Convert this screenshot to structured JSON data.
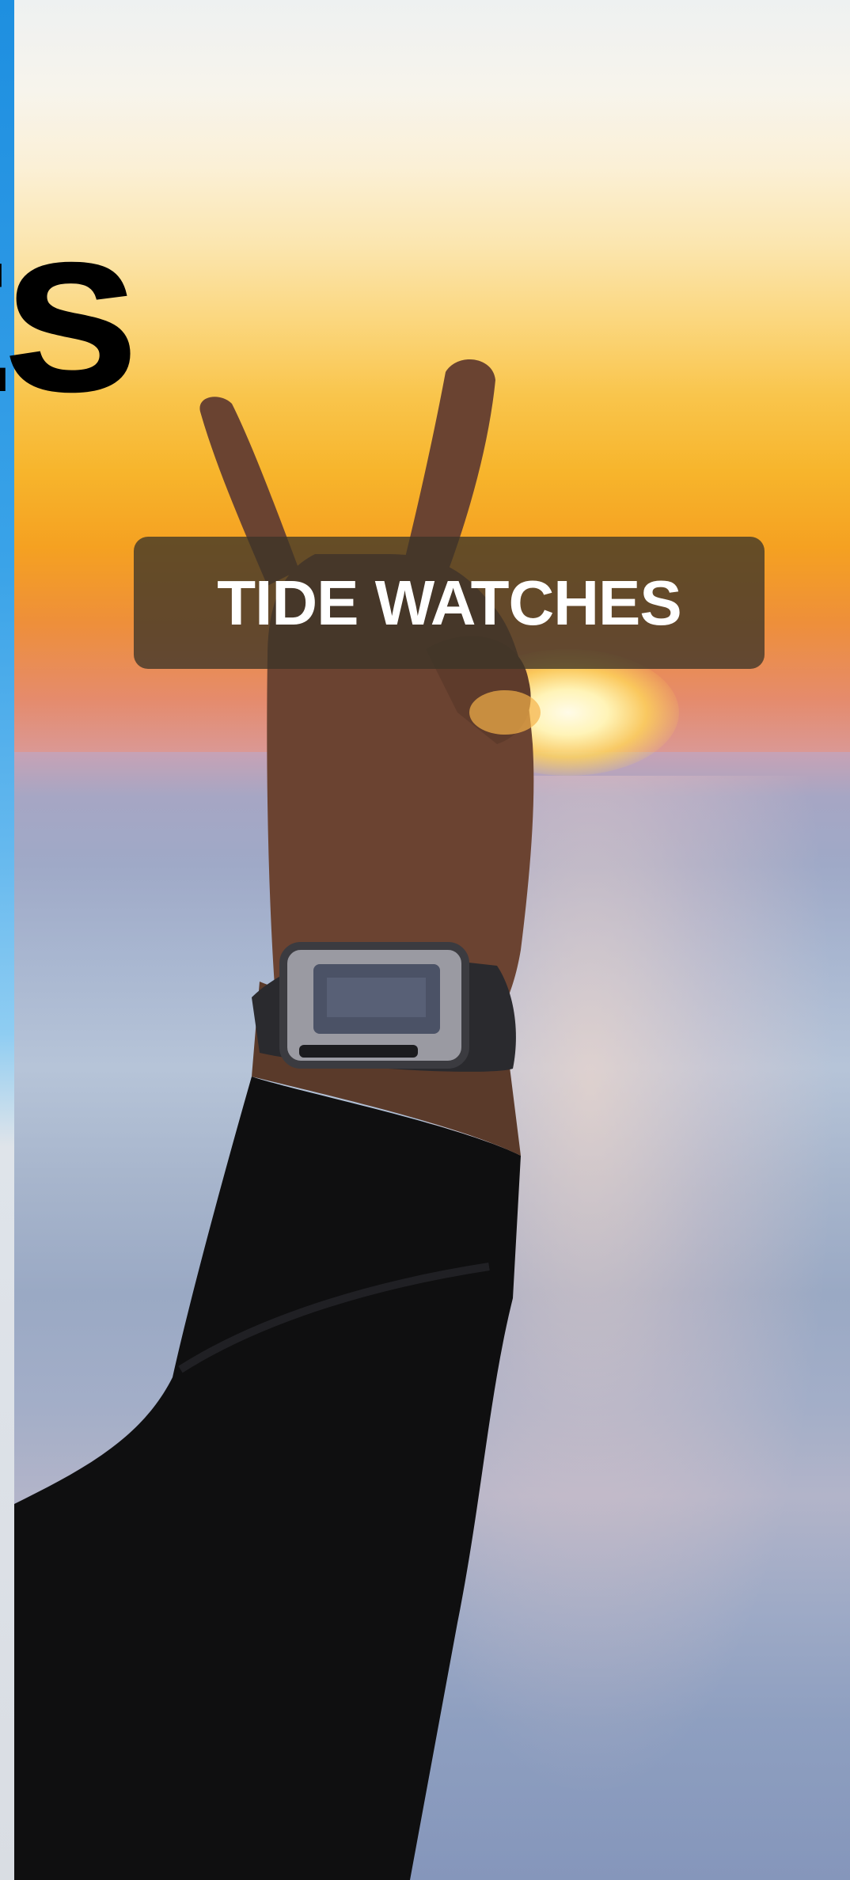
{
  "previous_slide": {
    "heading_fragment": "ES",
    "accent_color": "#1e8fe0"
  },
  "current_slide": {
    "title": "TIDE WATCHES",
    "image_subject": "raised-hand-peace-sign-with-watch-at-sunset"
  },
  "colors": {
    "label_background": "#3c3428",
    "label_text": "#ffffff",
    "sun": "#f7b52c"
  }
}
